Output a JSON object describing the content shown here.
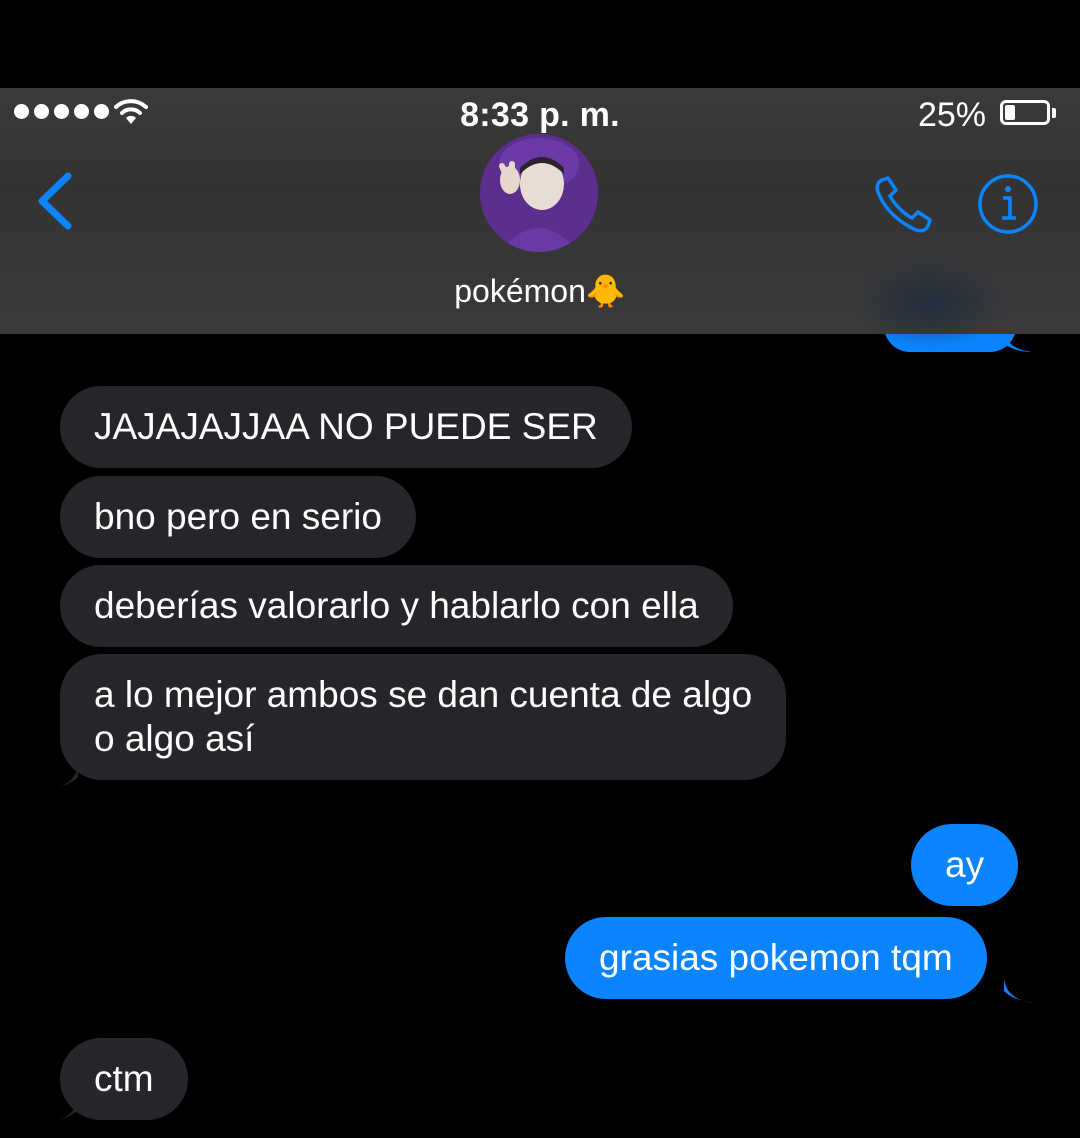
{
  "status_bar": {
    "time": "8:33 p. m.",
    "battery_percent": "25%",
    "signal_bars": 5,
    "icons": [
      "signal-dots-icon",
      "wifi-icon",
      "battery-icon"
    ]
  },
  "nav": {
    "contact_name": "pokémon🐥",
    "back_icon": "chevron-left-icon",
    "call_icon": "phone-icon",
    "info_icon": "info-icon",
    "accent_color": "#0a84ff"
  },
  "messages": [
    {
      "direction": "incoming",
      "text": "JAJAJAJJAA NO PUEDE SER"
    },
    {
      "direction": "incoming",
      "text": "bno pero en serio"
    },
    {
      "direction": "incoming",
      "text": "deberías valorarlo y hablarlo con ella"
    },
    {
      "direction": "incoming",
      "text": "a lo mejor ambos se dan cuenta de algo\no algo así"
    },
    {
      "direction": "outgoing",
      "text": "ay"
    },
    {
      "direction": "outgoing",
      "text": "grasias pokemon tqm"
    },
    {
      "direction": "incoming",
      "text": "ctm"
    }
  ],
  "colors": {
    "incoming_bubble": "#26252a",
    "outgoing_bubble": "#0a84ff",
    "background": "#000000"
  }
}
